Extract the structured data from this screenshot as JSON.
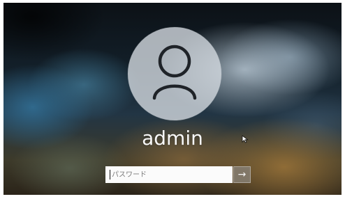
{
  "login": {
    "username": "admin",
    "password_placeholder": "パスワード",
    "submit_icon": "arrow-right-icon",
    "submit_glyph": "→",
    "avatar_icon": "user-icon",
    "pointer_icon": "mouse-pointer-icon"
  },
  "colors": {
    "username_text": "#f8f8f8",
    "avatar_fill": "#d3dae0",
    "avatar_icon": "#1f2328",
    "password_background": "#fbfbfb",
    "submit_background": "#837b6d"
  }
}
